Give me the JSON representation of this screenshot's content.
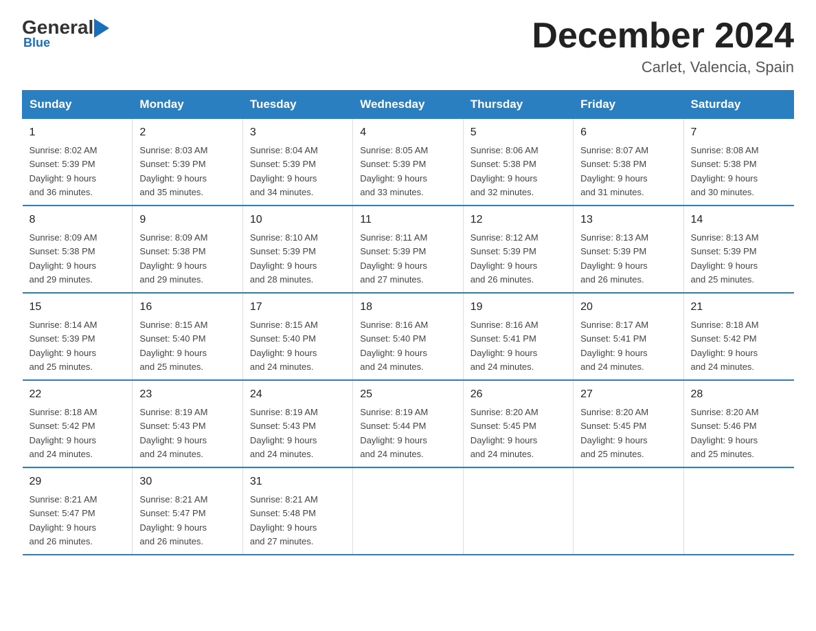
{
  "header": {
    "logo": {
      "general": "General",
      "blue": "Blue",
      "sub": "Blue"
    },
    "title": "December 2024",
    "location": "Carlet, Valencia, Spain"
  },
  "days_of_week": [
    "Sunday",
    "Monday",
    "Tuesday",
    "Wednesday",
    "Thursday",
    "Friday",
    "Saturday"
  ],
  "weeks": [
    [
      {
        "day": "1",
        "sunrise": "Sunrise: 8:02 AM",
        "sunset": "Sunset: 5:39 PM",
        "daylight": "Daylight: 9 hours",
        "daylight2": "and 36 minutes."
      },
      {
        "day": "2",
        "sunrise": "Sunrise: 8:03 AM",
        "sunset": "Sunset: 5:39 PM",
        "daylight": "Daylight: 9 hours",
        "daylight2": "and 35 minutes."
      },
      {
        "day": "3",
        "sunrise": "Sunrise: 8:04 AM",
        "sunset": "Sunset: 5:39 PM",
        "daylight": "Daylight: 9 hours",
        "daylight2": "and 34 minutes."
      },
      {
        "day": "4",
        "sunrise": "Sunrise: 8:05 AM",
        "sunset": "Sunset: 5:39 PM",
        "daylight": "Daylight: 9 hours",
        "daylight2": "and 33 minutes."
      },
      {
        "day": "5",
        "sunrise": "Sunrise: 8:06 AM",
        "sunset": "Sunset: 5:38 PM",
        "daylight": "Daylight: 9 hours",
        "daylight2": "and 32 minutes."
      },
      {
        "day": "6",
        "sunrise": "Sunrise: 8:07 AM",
        "sunset": "Sunset: 5:38 PM",
        "daylight": "Daylight: 9 hours",
        "daylight2": "and 31 minutes."
      },
      {
        "day": "7",
        "sunrise": "Sunrise: 8:08 AM",
        "sunset": "Sunset: 5:38 PM",
        "daylight": "Daylight: 9 hours",
        "daylight2": "and 30 minutes."
      }
    ],
    [
      {
        "day": "8",
        "sunrise": "Sunrise: 8:09 AM",
        "sunset": "Sunset: 5:38 PM",
        "daylight": "Daylight: 9 hours",
        "daylight2": "and 29 minutes."
      },
      {
        "day": "9",
        "sunrise": "Sunrise: 8:09 AM",
        "sunset": "Sunset: 5:38 PM",
        "daylight": "Daylight: 9 hours",
        "daylight2": "and 29 minutes."
      },
      {
        "day": "10",
        "sunrise": "Sunrise: 8:10 AM",
        "sunset": "Sunset: 5:39 PM",
        "daylight": "Daylight: 9 hours",
        "daylight2": "and 28 minutes."
      },
      {
        "day": "11",
        "sunrise": "Sunrise: 8:11 AM",
        "sunset": "Sunset: 5:39 PM",
        "daylight": "Daylight: 9 hours",
        "daylight2": "and 27 minutes."
      },
      {
        "day": "12",
        "sunrise": "Sunrise: 8:12 AM",
        "sunset": "Sunset: 5:39 PM",
        "daylight": "Daylight: 9 hours",
        "daylight2": "and 26 minutes."
      },
      {
        "day": "13",
        "sunrise": "Sunrise: 8:13 AM",
        "sunset": "Sunset: 5:39 PM",
        "daylight": "Daylight: 9 hours",
        "daylight2": "and 26 minutes."
      },
      {
        "day": "14",
        "sunrise": "Sunrise: 8:13 AM",
        "sunset": "Sunset: 5:39 PM",
        "daylight": "Daylight: 9 hours",
        "daylight2": "and 25 minutes."
      }
    ],
    [
      {
        "day": "15",
        "sunrise": "Sunrise: 8:14 AM",
        "sunset": "Sunset: 5:39 PM",
        "daylight": "Daylight: 9 hours",
        "daylight2": "and 25 minutes."
      },
      {
        "day": "16",
        "sunrise": "Sunrise: 8:15 AM",
        "sunset": "Sunset: 5:40 PM",
        "daylight": "Daylight: 9 hours",
        "daylight2": "and 25 minutes."
      },
      {
        "day": "17",
        "sunrise": "Sunrise: 8:15 AM",
        "sunset": "Sunset: 5:40 PM",
        "daylight": "Daylight: 9 hours",
        "daylight2": "and 24 minutes."
      },
      {
        "day": "18",
        "sunrise": "Sunrise: 8:16 AM",
        "sunset": "Sunset: 5:40 PM",
        "daylight": "Daylight: 9 hours",
        "daylight2": "and 24 minutes."
      },
      {
        "day": "19",
        "sunrise": "Sunrise: 8:16 AM",
        "sunset": "Sunset: 5:41 PM",
        "daylight": "Daylight: 9 hours",
        "daylight2": "and 24 minutes."
      },
      {
        "day": "20",
        "sunrise": "Sunrise: 8:17 AM",
        "sunset": "Sunset: 5:41 PM",
        "daylight": "Daylight: 9 hours",
        "daylight2": "and 24 minutes."
      },
      {
        "day": "21",
        "sunrise": "Sunrise: 8:18 AM",
        "sunset": "Sunset: 5:42 PM",
        "daylight": "Daylight: 9 hours",
        "daylight2": "and 24 minutes."
      }
    ],
    [
      {
        "day": "22",
        "sunrise": "Sunrise: 8:18 AM",
        "sunset": "Sunset: 5:42 PM",
        "daylight": "Daylight: 9 hours",
        "daylight2": "and 24 minutes."
      },
      {
        "day": "23",
        "sunrise": "Sunrise: 8:19 AM",
        "sunset": "Sunset: 5:43 PM",
        "daylight": "Daylight: 9 hours",
        "daylight2": "and 24 minutes."
      },
      {
        "day": "24",
        "sunrise": "Sunrise: 8:19 AM",
        "sunset": "Sunset: 5:43 PM",
        "daylight": "Daylight: 9 hours",
        "daylight2": "and 24 minutes."
      },
      {
        "day": "25",
        "sunrise": "Sunrise: 8:19 AM",
        "sunset": "Sunset: 5:44 PM",
        "daylight": "Daylight: 9 hours",
        "daylight2": "and 24 minutes."
      },
      {
        "day": "26",
        "sunrise": "Sunrise: 8:20 AM",
        "sunset": "Sunset: 5:45 PM",
        "daylight": "Daylight: 9 hours",
        "daylight2": "and 24 minutes."
      },
      {
        "day": "27",
        "sunrise": "Sunrise: 8:20 AM",
        "sunset": "Sunset: 5:45 PM",
        "daylight": "Daylight: 9 hours",
        "daylight2": "and 25 minutes."
      },
      {
        "day": "28",
        "sunrise": "Sunrise: 8:20 AM",
        "sunset": "Sunset: 5:46 PM",
        "daylight": "Daylight: 9 hours",
        "daylight2": "and 25 minutes."
      }
    ],
    [
      {
        "day": "29",
        "sunrise": "Sunrise: 8:21 AM",
        "sunset": "Sunset: 5:47 PM",
        "daylight": "Daylight: 9 hours",
        "daylight2": "and 26 minutes."
      },
      {
        "day": "30",
        "sunrise": "Sunrise: 8:21 AM",
        "sunset": "Sunset: 5:47 PM",
        "daylight": "Daylight: 9 hours",
        "daylight2": "and 26 minutes."
      },
      {
        "day": "31",
        "sunrise": "Sunrise: 8:21 AM",
        "sunset": "Sunset: 5:48 PM",
        "daylight": "Daylight: 9 hours",
        "daylight2": "and 27 minutes."
      },
      null,
      null,
      null,
      null
    ]
  ]
}
